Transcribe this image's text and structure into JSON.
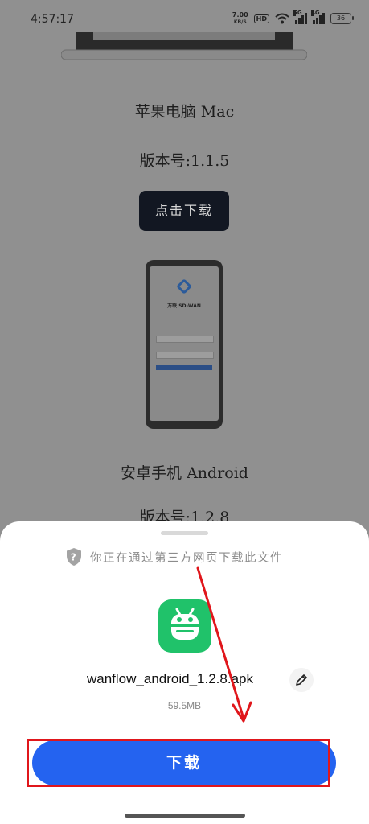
{
  "status_bar": {
    "time": "4:57:17",
    "speed_value": "7.00",
    "speed_unit": "KB/S",
    "hd_badge": "HD",
    "sim1_network": "5G",
    "sim2_network": "4G",
    "battery_level": "36"
  },
  "background_page": {
    "mac": {
      "name": "苹果电脑 Mac",
      "version": "版本号:1.1.5",
      "button_label": "点击下载"
    },
    "android_preview": {
      "title": "万联 SD-WAN"
    },
    "android": {
      "name": "安卓手机 Android",
      "version": "版本号:1.2.8"
    }
  },
  "download_sheet": {
    "warning_text": "你正在通过第三方网页下载此文件",
    "app_icon": "android-robot-icon",
    "file_name": "wanflow_android_1.2.8.apk",
    "file_size": "59.5MB",
    "download_button": "下载"
  },
  "colors": {
    "primary_button": "#2463f0",
    "app_icon_bg": "#20c26a",
    "annotation": "#e0161b",
    "scrim": "#909090"
  }
}
